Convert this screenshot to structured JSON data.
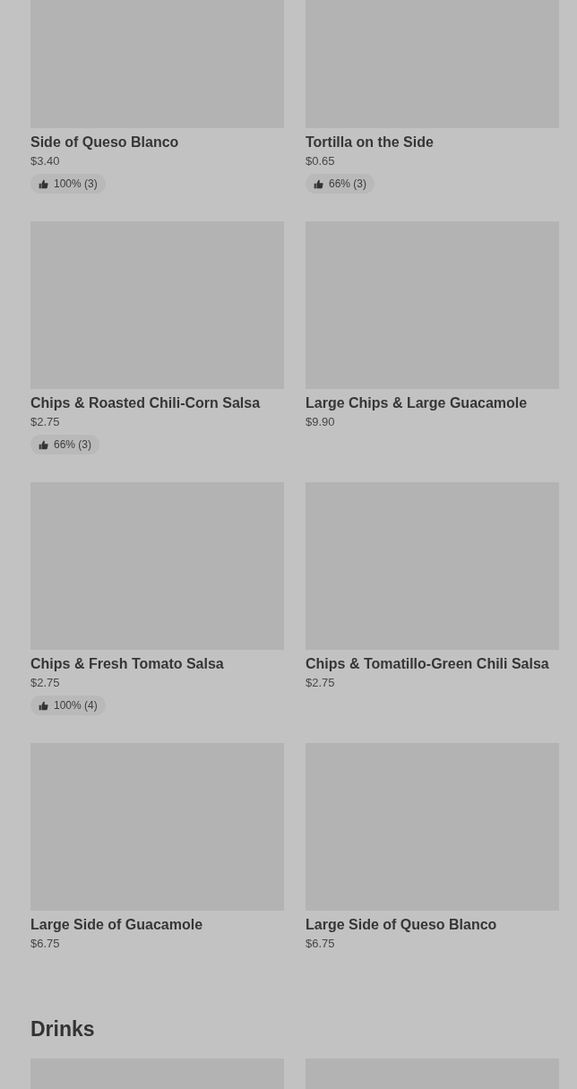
{
  "items": [
    {
      "name": "Side of Queso Blanco",
      "price": "$3.40",
      "rating": "100% (3)"
    },
    {
      "name": "Tortilla on the Side",
      "price": "$0.65",
      "rating": "66% (3)"
    },
    {
      "name": "Chips & Roasted Chili-Corn Salsa",
      "price": "$2.75",
      "rating": "66% (3)"
    },
    {
      "name": "Large Chips & Large Guacamole",
      "price": "$9.90"
    },
    {
      "name": "Chips & Fresh Tomato Salsa",
      "price": "$2.75",
      "rating": "100% (4)"
    },
    {
      "name": "Chips & Tomatillo-Green Chili Salsa",
      "price": "$2.75"
    },
    {
      "name": "Large Side of Guacamole",
      "price": "$6.75"
    },
    {
      "name": "Large Side of Queso Blanco",
      "price": "$6.75"
    }
  ],
  "drinks": {
    "title": "Drinks",
    "items": [
      {
        "kind": "image"
      },
      {
        "kind": "image"
      }
    ]
  }
}
